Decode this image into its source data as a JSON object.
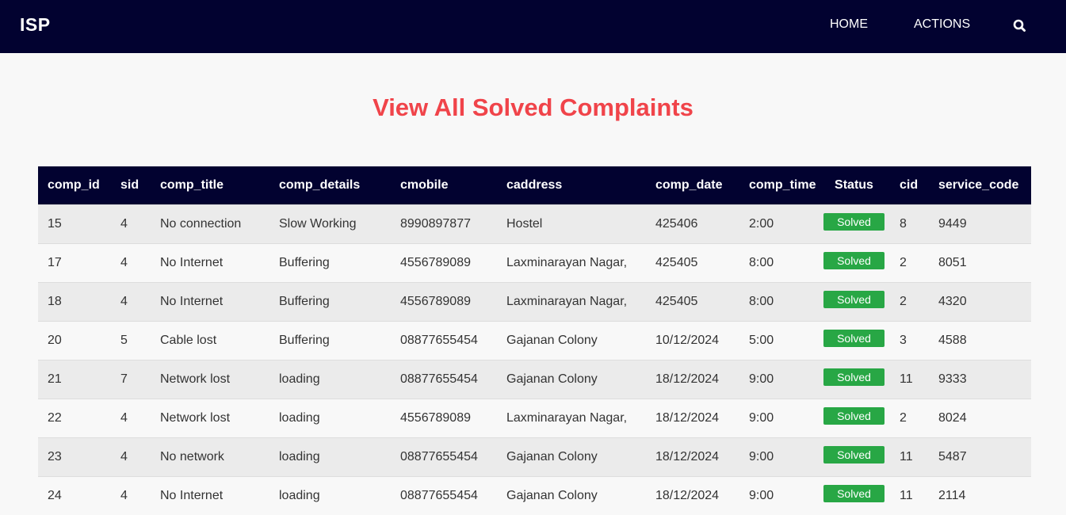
{
  "navbar": {
    "brand": "ISP",
    "links": [
      {
        "label": "HOME"
      },
      {
        "label": "ACTIONS"
      }
    ],
    "search_icon": "search-icon"
  },
  "page": {
    "title": "View All Solved Complaints"
  },
  "colors": {
    "navbar_bg": "#020230",
    "title": "#f0444a",
    "badge_bg": "#28a745"
  },
  "table": {
    "headers": [
      "comp_id",
      "sid",
      "comp_title",
      "comp_details",
      "cmobile",
      "caddress",
      "comp_date",
      "comp_time",
      "Status",
      "cid",
      "service_code"
    ],
    "rows": [
      [
        "15",
        "4",
        "No connection",
        "Slow Working",
        "8990897877",
        "Hostel",
        "425406",
        "2:00",
        "Solved",
        "8",
        "9449"
      ],
      [
        "17",
        "4",
        "No Internet",
        "Buffering",
        "4556789089",
        "Laxminarayan Nagar,",
        "425405",
        "8:00",
        "Solved",
        "2",
        "8051"
      ],
      [
        "18",
        "4",
        "No Internet",
        "Buffering",
        "4556789089",
        "Laxminarayan Nagar,",
        "425405",
        "8:00",
        "Solved",
        "2",
        "4320"
      ],
      [
        "20",
        "5",
        "Cable lost",
        "Buffering",
        "08877655454",
        "Gajanan Colony",
        "10/12/2024",
        "5:00",
        "Solved",
        "3",
        "4588"
      ],
      [
        "21",
        "7",
        "Network lost",
        "loading",
        "08877655454",
        "Gajanan Colony",
        "18/12/2024",
        "9:00",
        "Solved",
        "11",
        "9333"
      ],
      [
        "22",
        "4",
        "Network lost",
        "loading",
        "4556789089",
        "Laxminarayan Nagar,",
        "18/12/2024",
        "9:00",
        "Solved",
        "2",
        "8024"
      ],
      [
        "23",
        "4",
        "No network",
        "loading",
        "08877655454",
        "Gajanan Colony",
        "18/12/2024",
        "9:00",
        "Solved",
        "11",
        "5487"
      ],
      [
        "24",
        "4",
        "No Internet",
        "loading",
        "08877655454",
        "Gajanan Colony",
        "18/12/2024",
        "9:00",
        "Solved",
        "11",
        "2114"
      ]
    ]
  }
}
